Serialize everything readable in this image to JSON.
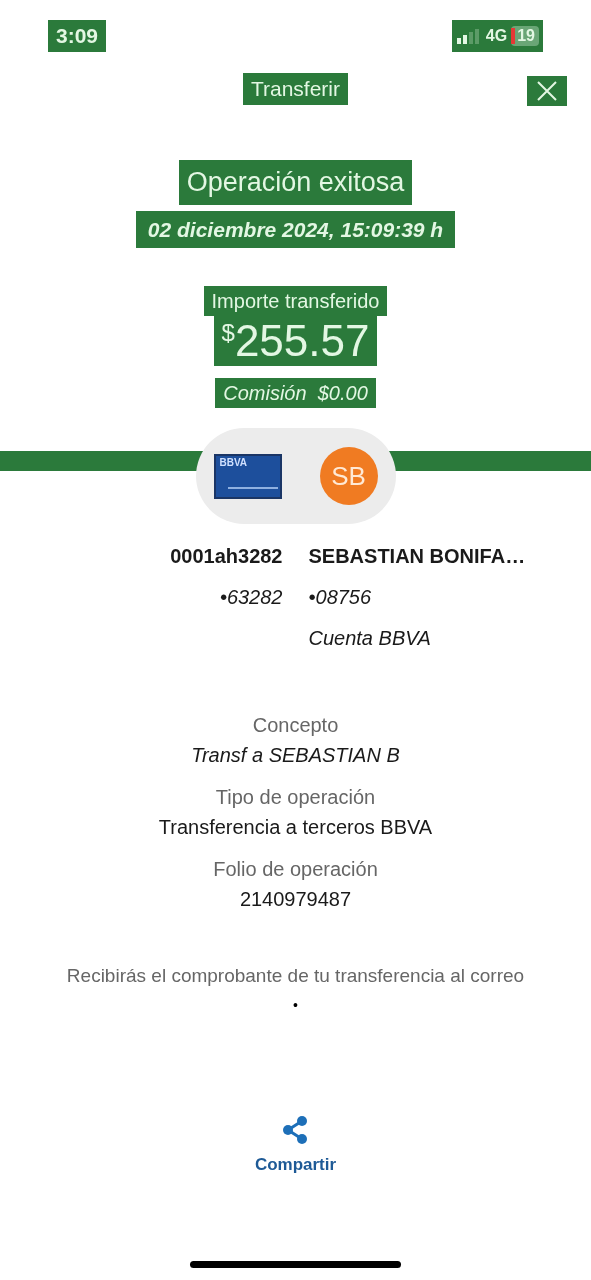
{
  "status_bar": {
    "time": "3:09",
    "network": "4G",
    "battery": "19"
  },
  "header": {
    "title": "Transferir"
  },
  "result": {
    "heading": "Operación exitosa",
    "datetime": "02 diciembre 2024, 15:09:39 h",
    "amount_label": "Importe transferido",
    "currency": "$",
    "amount": "255.57",
    "commission": "Comisión  $0.00"
  },
  "accounts": {
    "card_brand": "BBVA",
    "recipient_initials": "SB",
    "origin": {
      "name": "0001ah3282",
      "number": "•63282"
    },
    "destination": {
      "name": "SEBASTIAN BONIFA…",
      "number": "•08756",
      "bank": "Cuenta BBVA"
    }
  },
  "details": [
    {
      "label": "Concepto",
      "value": "Transf a SEBASTIAN B",
      "italic": true
    },
    {
      "label": "Tipo de operación",
      "value": "Transferencia a terceros BBVA",
      "italic": false
    },
    {
      "label": "Folio de operación",
      "value": "2140979487",
      "italic": false
    }
  ],
  "notice": {
    "text": "Recibirás el comprobante de tu transferencia al correo",
    "email": "•"
  },
  "actions": [
    {
      "label": "Compartir"
    }
  ]
}
